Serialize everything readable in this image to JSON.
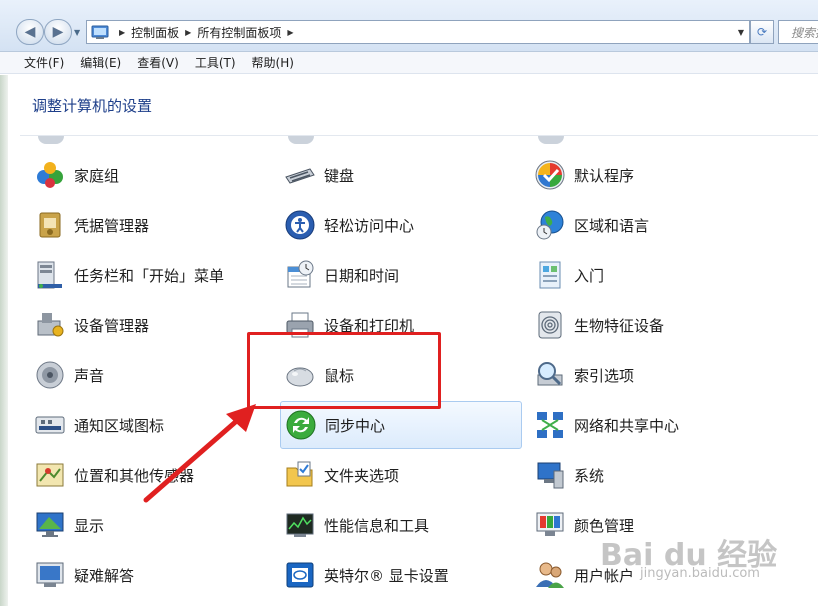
{
  "address_bar": {
    "breadcrumb": [
      "控制面板",
      "所有控制面板项"
    ],
    "search_placeholder": "搜索控"
  },
  "menu": [
    "文件(F)",
    "编辑(E)",
    "查看(V)",
    "工具(T)",
    "帮助(H)"
  ],
  "page_title": "调整计算机的设置",
  "items": [
    {
      "label": "家庭组",
      "icon": "homegroup-icon"
    },
    {
      "label": "键盘",
      "icon": "keyboard-icon"
    },
    {
      "label": "默认程序",
      "icon": "default-programs-icon"
    },
    {
      "label": "凭据管理器",
      "icon": "credential-manager-icon"
    },
    {
      "label": "轻松访问中心",
      "icon": "ease-of-access-icon"
    },
    {
      "label": "区域和语言",
      "icon": "region-language-icon"
    },
    {
      "label": "任务栏和「开始」菜单",
      "icon": "taskbar-icon"
    },
    {
      "label": "日期和时间",
      "icon": "calendar-clock-icon"
    },
    {
      "label": "入门",
      "icon": "getting-started-icon"
    },
    {
      "label": "设备管理器",
      "icon": "device-manager-icon"
    },
    {
      "label": "设备和打印机",
      "icon": "printer-icon"
    },
    {
      "label": "生物特征设备",
      "icon": "fingerprint-icon"
    },
    {
      "label": "声音",
      "icon": "speaker-icon"
    },
    {
      "label": "鼠标",
      "icon": "mouse-icon"
    },
    {
      "label": "索引选项",
      "icon": "indexing-icon"
    },
    {
      "label": "通知区域图标",
      "icon": "notification-area-icon"
    },
    {
      "label": "同步中心",
      "icon": "sync-center-icon"
    },
    {
      "label": "网络和共享中心",
      "icon": "network-icon"
    },
    {
      "label": "位置和其他传感器",
      "icon": "location-sensor-icon"
    },
    {
      "label": "文件夹选项",
      "icon": "folder-options-icon"
    },
    {
      "label": "系统",
      "icon": "system-icon"
    },
    {
      "label": "显示",
      "icon": "display-icon"
    },
    {
      "label": "性能信息和工具",
      "icon": "performance-icon"
    },
    {
      "label": "颜色管理",
      "icon": "color-management-icon"
    },
    {
      "label": "疑难解答",
      "icon": "troubleshooting-icon"
    },
    {
      "label": "英特尔® 显卡设置",
      "icon": "intel-graphics-icon"
    },
    {
      "label": "用户帐户",
      "icon": "user-accounts-icon"
    }
  ],
  "watermark": {
    "logo": "Bai du 经验",
    "url": "jingyan.baidu.com"
  },
  "colors": {
    "annotation": "#e02020",
    "title": "#1e3f8a",
    "hover_border": "#aacbf0"
  }
}
